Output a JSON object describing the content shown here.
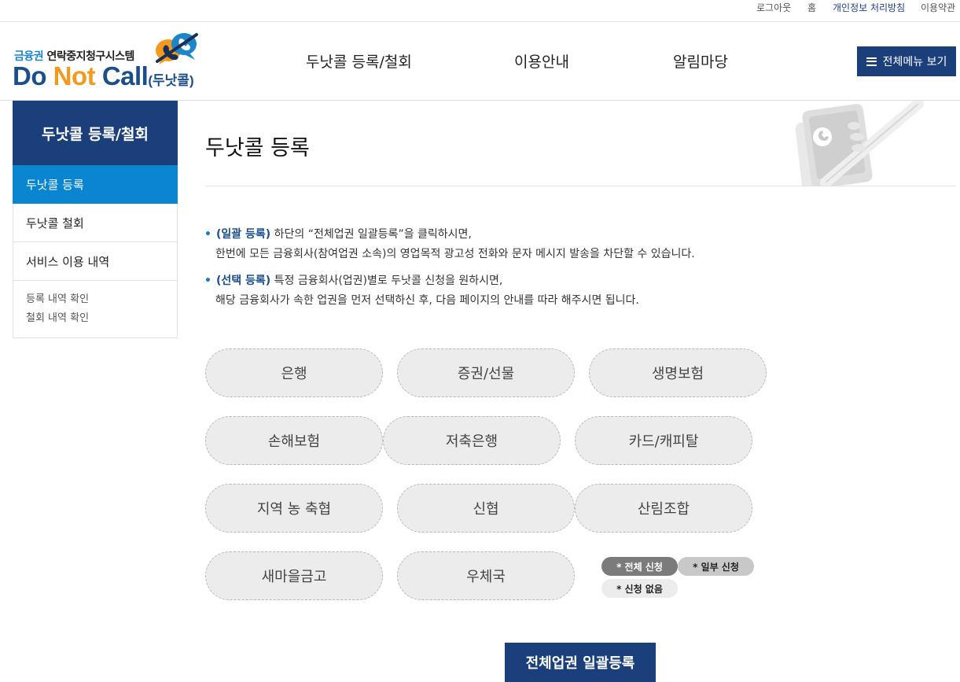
{
  "util": {
    "logout": "로그아웃",
    "home": "홈",
    "privacy": "개인정보 처리방침",
    "terms": "이용약관"
  },
  "logo": {
    "top_blue": "금융권",
    "top_rest": " 연락중지청구시스템",
    "do": "Do ",
    "not": "Not ",
    "call": "Call",
    "paren": "(두낫콜)"
  },
  "gnb": {
    "item1": "두낫콜 등록/철회",
    "item2": "이용안내",
    "item3": "알림마당",
    "all_menu": "전체메뉴 보기"
  },
  "lnb": {
    "title": "두낫콜 등록/철회",
    "items": [
      "두낫콜 등록",
      "두낫콜 철회",
      "서비스 이용 내역"
    ],
    "sub": [
      "등록 내역 확인",
      "철회 내역 확인"
    ]
  },
  "content": {
    "title": "두낫콜 등록",
    "info1_strong": "(일괄 등록)",
    "info1_rest": " 하단의 “전체업권 일괄등록”을 클릭하시면,",
    "info1_line2": "한번에 모든 금융회사(참여업권 소속)의 영업목적 광고성 전화와 문자 메시지 발송을 차단할 수 있습니다.",
    "info2_strong": "(선택 등록)",
    "info2_rest": " 특정 금융회사(업권)별로 두낫콜 신청을 원하시면,",
    "info2_line2": "해당 금융회사가 속한 업권을 먼저 선택하신 후, 다음 페이지의 안내를 따라 해주시면 됩니다."
  },
  "sectors": [
    "은행",
    "증권/선물",
    "생명보험",
    "손해보험",
    "저축은행",
    "카드/캐피탈",
    "지역 농 축협",
    "신협",
    "산림조합",
    "새마을금고",
    "우체국"
  ],
  "legend": {
    "full": "* 전체 신청",
    "part": "* 일부 신청",
    "none": "* 신청 없음"
  },
  "cta": "전체업권 일괄등록",
  "colors": {
    "navy": "#1b3f7a",
    "active_blue": "#0a86d0",
    "logo_orange": "#f39a1e"
  }
}
